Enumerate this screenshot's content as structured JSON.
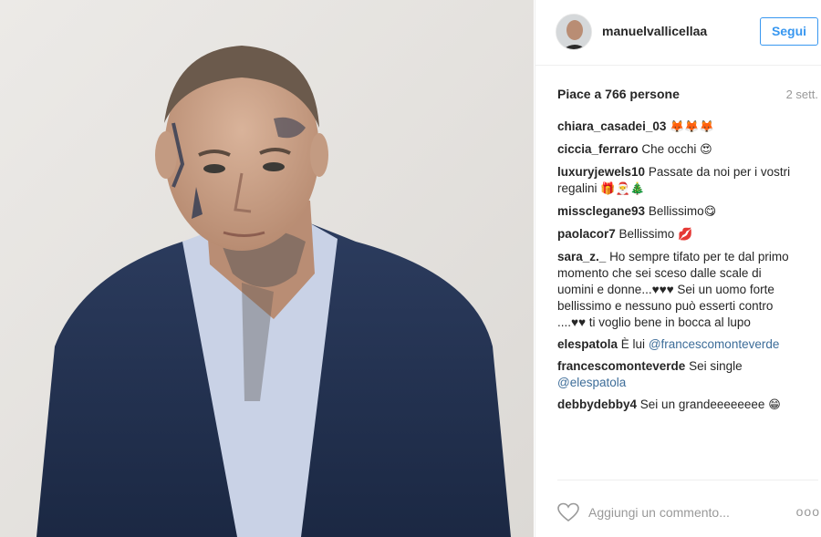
{
  "post": {
    "author": "manuelvallicellaa",
    "follow_label": "Segui",
    "likes_text": "Piace a 766 persone",
    "age_text": "2 sett.",
    "photo_alt": "Ritratto di un uomo con tatuaggi in giacca blu"
  },
  "comments": [
    {
      "user": "chiara_casadei_03",
      "text": "",
      "emoji": "🦊🦊🦊"
    },
    {
      "user": "ciccia_ferraro",
      "text": "Che occhi",
      "emoji": "😍"
    },
    {
      "user": "luxuryjewels10",
      "text": "Passate da noi per i vostri regalini",
      "emoji": "🎁🎅🎄"
    },
    {
      "user": "missclegane93",
      "text": "Bellissimo",
      "emoji": "😋"
    },
    {
      "user": "paolacor7",
      "text": "Bellissimo",
      "emoji": "💋"
    },
    {
      "user": "sara_z._",
      "text": "Ho sempre tifato per te dal primo momento che sei sceso dalle scale di uomini e donne...♥♥♥ Sei un uomo forte bellissimo e nessuno può esserti contro ....♥♥ ti voglio bene in bocca al lupo",
      "emoji": ""
    },
    {
      "user": "elespatola",
      "text": "È lui",
      "mention": "@francescomonteverde",
      "emoji": ""
    },
    {
      "user": "francescomonteverde",
      "text": "Sei single",
      "mention": "@elespatola",
      "emoji": ""
    },
    {
      "user": "debbydebby4",
      "text": "Sei un grandeeeeeeee",
      "emoji": "😁"
    }
  ],
  "footer": {
    "comment_placeholder": "Aggiungi un commento...",
    "more_label": "ooo"
  },
  "icons": {
    "heart": "heart-icon",
    "more": "more-options-icon"
  },
  "colors": {
    "link": "#3897f0",
    "mention": "#3d6d99",
    "muted": "#999999"
  }
}
